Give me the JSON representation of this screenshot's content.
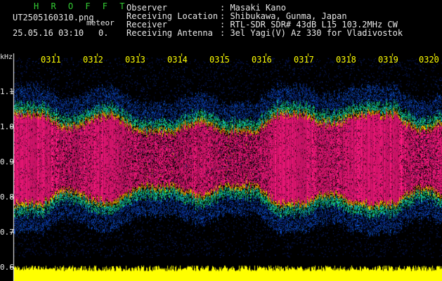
{
  "app": {
    "title": "H R O F F T"
  },
  "file": {
    "name": "UT2505160310.png",
    "mode": "meteor",
    "datetime": "25.05.16 03:10",
    "speed": "0."
  },
  "info": [
    {
      "label": "Observer",
      "value": ": Masaki Kano"
    },
    {
      "label": "Receiving Location",
      "value": ": Shibukawa, Gunma, Japan"
    },
    {
      "label": "Receiver",
      "value": ": RTL-SDR SDR# 43dB L15 103.2MHz CW"
    },
    {
      "label": "Receiving Antenna",
      "value": ": 3el Yagi(V) Az 330 for Vladivostok"
    }
  ],
  "axis": {
    "unit": "kHz",
    "y_ticks": [
      "1.1",
      "1.0",
      "0.9",
      "0.8",
      "0.7",
      "0.6"
    ],
    "time_ticks": [
      "0311",
      "0312",
      "0313",
      "0314",
      "0315",
      "0316",
      "0317",
      "0318",
      "0319",
      "0320"
    ]
  },
  "colors": {
    "background": "#000000",
    "title": "#33cc33",
    "text": "#e8e8e8",
    "tick": "#ffff00",
    "signal": "#ff1a80",
    "amplitude": "#ffff00"
  }
}
